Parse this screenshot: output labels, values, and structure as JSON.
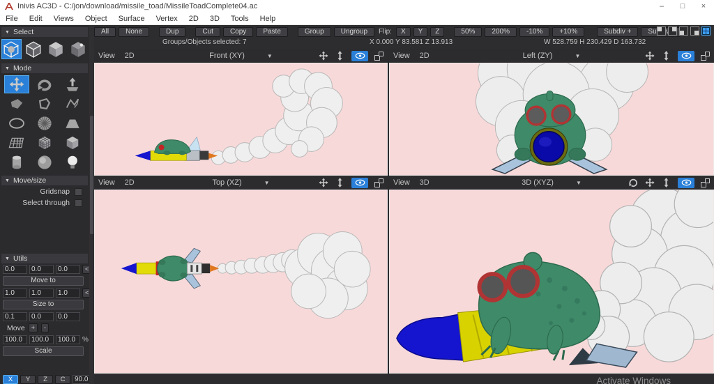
{
  "window": {
    "title": "Inivis AC3D - C:/jon/download/missile_toad/MissileToadComplete04.ac",
    "controls": {
      "minimize": "–",
      "maximize": "□",
      "close": "×"
    }
  },
  "menu": {
    "items": [
      "File",
      "Edit",
      "Views",
      "Object",
      "Surface",
      "Vertex",
      "2D",
      "3D",
      "Tools",
      "Help"
    ]
  },
  "toolbar": {
    "all": "All",
    "none": "None",
    "dup": "Dup",
    "cut": "Cut",
    "copy": "Copy",
    "paste": "Paste",
    "group": "Group",
    "ungroup": "Ungroup",
    "flip_label": "Flip:",
    "flip_x": "X",
    "flip_y": "Y",
    "flip_z": "Z",
    "zoom_50": "50%",
    "zoom_200": "200%",
    "zoom_minus": "-10%",
    "zoom_plus": "+10%",
    "subdiv_plus": "Subdiv +",
    "subdiv_minus": "Subdiv -"
  },
  "status": {
    "selection": "Groups/Objects selected: 7",
    "position": "X 0.000 Y 83.581 Z 13.913",
    "dimensions": "W 528.759 H 230.429 D 163.732"
  },
  "sidebar": {
    "select": {
      "title": "Select"
    },
    "mode": {
      "title": "Mode"
    },
    "move_size": {
      "title": "Move/size",
      "gridsnap": "Gridsnap",
      "select_through": "Select through"
    },
    "utils": {
      "title": "Utils",
      "move_to": {
        "x": "0.0",
        "y": "0.0",
        "z": "0.0",
        "expand": "<",
        "button": "Move to"
      },
      "size_to": {
        "x": "1.0",
        "y": "1.0",
        "z": "1.0",
        "expand": "<",
        "button": "Size to"
      },
      "move": {
        "x": "0.1",
        "y": "0.0",
        "z": "0.0",
        "label": "Move",
        "plus": "+",
        "minus": "-"
      },
      "scale": {
        "x": "100.0",
        "y": "100.0",
        "z": "100.0",
        "percent": "%",
        "button": "Scale"
      },
      "axis": {
        "x": "X",
        "y": "Y",
        "z": "Z",
        "c": "C",
        "angle": "90.0"
      }
    }
  },
  "viewports": {
    "front": {
      "view_label": "View",
      "mode": "2D",
      "projection": "Front (XY)"
    },
    "left": {
      "view_label": "View",
      "mode": "2D",
      "projection": "Left (ZY)"
    },
    "top": {
      "view_label": "View",
      "mode": "2D",
      "projection": "Top (XZ)"
    },
    "three_d": {
      "view_label": "View",
      "mode": "3D",
      "projection": "3D (XYZ)"
    }
  },
  "icons": {
    "caret": "▼",
    "section_caret": "▼"
  },
  "colors": {
    "accent_blue": "#2a80d8",
    "viewport_background": "#f8d9d9",
    "toolbar_background": "#2d2d30",
    "titlebar_background": "#ffffff",
    "toad_green": "#3f8a68",
    "missile_yellow": "#e2db08",
    "nose_blue": "#1515cf",
    "goggle_red": "#b03434",
    "fin_blue": "#a9c3dd",
    "flame_orange": "#e07820",
    "smoke_white": "#efefef",
    "watermark_color": "#8e8e8e"
  },
  "watermark": "Activate Windows"
}
